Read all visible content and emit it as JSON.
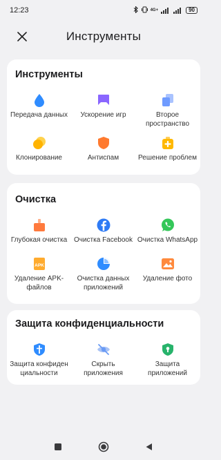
{
  "status": {
    "time": "12:23",
    "network": "4G+",
    "battery": "90"
  },
  "header": {
    "title": "Инструменты"
  },
  "sections": [
    {
      "title": "Инструменты",
      "items": [
        {
          "label": "Передача данных",
          "icon": "water-drop-icon",
          "color": "#2f8cff"
        },
        {
          "label": "Ускорение игр",
          "icon": "gamepad-icon",
          "color": "#8a66ff"
        },
        {
          "label": "Второе пространство",
          "icon": "dual-space-icon",
          "color": "#6f9bff"
        },
        {
          "label": "Клонирование",
          "icon": "clone-icon",
          "color": "#ffb300"
        },
        {
          "label": "Антиспам",
          "icon": "shield-icon",
          "color": "#ff7a2f"
        },
        {
          "label": "Решение проблем",
          "icon": "first-aid-icon",
          "color": "#ffb800"
        }
      ]
    },
    {
      "title": "Очистка",
      "items": [
        {
          "label": "Глубокая очистка",
          "icon": "broom-icon",
          "color": "#ff7a3d"
        },
        {
          "label": "Очистка Facebook",
          "icon": "facebook-icon",
          "color": "#2f7bf5"
        },
        {
          "label": "Очистка WhatsApp",
          "icon": "whatsapp-icon",
          "color": "#34c759"
        },
        {
          "label": "Удаление APK-файлов",
          "icon": "apk-icon",
          "color": "#ffab2e",
          "badge": "APK"
        },
        {
          "label": "Очистка данных приложений",
          "icon": "pie-chart-icon",
          "color": "#2f8cff"
        },
        {
          "label": "Удаление фото",
          "icon": "photo-icon",
          "color": "#ff8a3d"
        }
      ]
    },
    {
      "title": "Защита конфиденциальности",
      "items": [
        {
          "label": "Защита конфиден циальности",
          "icon": "privacy-shield-icon",
          "color": "#2f8cff"
        },
        {
          "label": "Скрыть приложения",
          "icon": "hidden-eye-icon",
          "color": "#6a9bf5"
        },
        {
          "label": "Защита приложений",
          "icon": "app-lock-shield-icon",
          "color": "#27b36b"
        }
      ]
    }
  ]
}
